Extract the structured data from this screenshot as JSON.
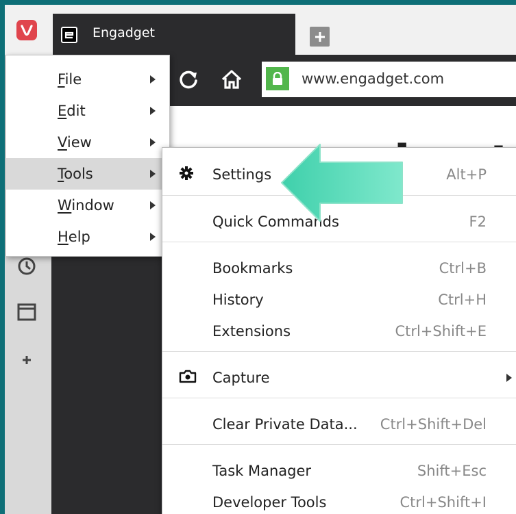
{
  "tab": {
    "title": "Engadget"
  },
  "address": {
    "url": "www.engadget.com"
  },
  "page": {
    "logo_fragment": "engadget"
  },
  "main_menu": {
    "items": [
      {
        "label": "File",
        "accel": "F"
      },
      {
        "label": "Edit",
        "accel": "E"
      },
      {
        "label": "View",
        "accel": "V"
      },
      {
        "label": "Tools",
        "accel": "T"
      },
      {
        "label": "Window",
        "accel": "W"
      },
      {
        "label": "Help",
        "accel": "H"
      }
    ]
  },
  "tools_menu": {
    "settings": {
      "label": "Settings",
      "shortcut": "Alt+P"
    },
    "quick_commands": {
      "label": "Quick Commands",
      "shortcut": "F2"
    },
    "bookmarks": {
      "label": "Bookmarks",
      "shortcut": "Ctrl+B"
    },
    "history": {
      "label": "History",
      "shortcut": "Ctrl+H"
    },
    "extensions": {
      "label": "Extensions",
      "shortcut": "Ctrl+Shift+E"
    },
    "capture": {
      "label": "Capture"
    },
    "clear_private_data": {
      "label": "Clear Private Data...",
      "shortcut": "Ctrl+Shift+Del"
    },
    "task_manager": {
      "label": "Task Manager",
      "shortcut": "Shift+Esc"
    },
    "developer_tools": {
      "label": "Developer Tools",
      "shortcut": "Ctrl+Shift+I"
    }
  },
  "colors": {
    "border_teal": "#0e6f77",
    "vivaldi_red": "#e0454d",
    "dark_chrome": "#2b2b2d",
    "lock_green": "#52b64c",
    "highlight": "#d9d9d9",
    "annotation_arrow": "#4fd6b4"
  },
  "icons": [
    "vivaldi-logo-icon",
    "engadget-favicon-icon",
    "new-tab-icon",
    "reload-icon",
    "home-icon",
    "lock-icon",
    "history-clock-icon",
    "window-panel-icon",
    "add-panel-icon",
    "gear-icon",
    "camera-icon",
    "annotation-arrow-icon"
  ]
}
